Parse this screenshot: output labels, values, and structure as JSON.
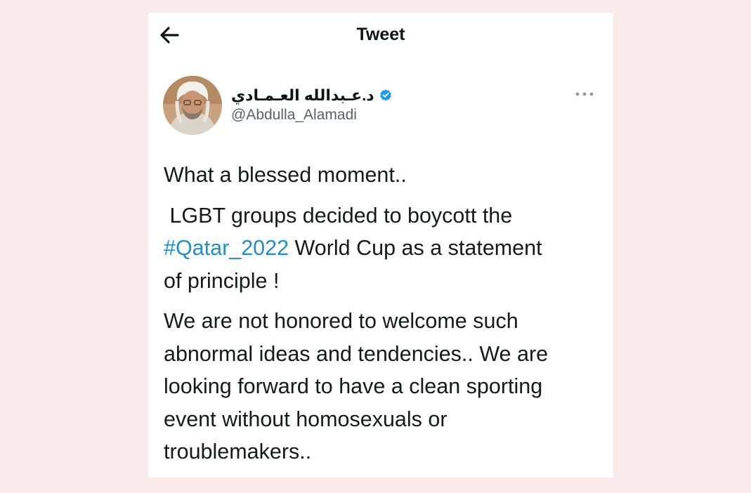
{
  "header": {
    "title": "Tweet",
    "back_icon": "arrow-left-icon"
  },
  "author": {
    "display_name": "د.عـبدالله العـمـادي",
    "handle": "@Abdulla_Alamadi",
    "verified_icon": "verified-badge-icon",
    "verified_color": "#1d9bf0"
  },
  "menu": {
    "more_icon": "more-horizontal-icon"
  },
  "tweet": {
    "paragraph_1": "What a blessed moment..",
    "paragraph_2_line_1": " LGBT groups decided to boycott the",
    "hashtag": "#Qatar_2022",
    "paragraph_2_after_hashtag": " World Cup as a statement",
    "paragraph_2_line_3": "of principle !",
    "paragraph_3_line_1": "We are not honored to welcome such",
    "paragraph_3_line_2": "abnormal ideas and tendencies.. We are",
    "paragraph_3_line_3": "looking forward to have a clean sporting",
    "paragraph_3_line_4": "event without homosexuals or",
    "paragraph_3_line_5": "troublemakers.."
  },
  "colors": {
    "page_background": "#fbeaec",
    "card_background": "#ffffff",
    "hashtag": "#1d8fd0",
    "handle": "#53646f"
  }
}
